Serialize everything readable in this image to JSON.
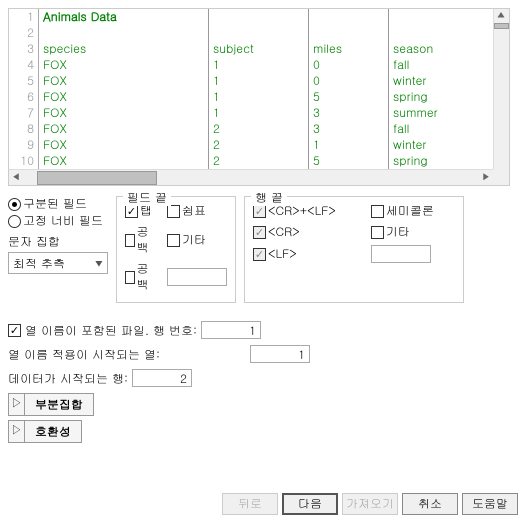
{
  "preview": {
    "line_numbers": [
      "1",
      "2",
      "3",
      "4",
      "5",
      "6",
      "7",
      "8",
      "9",
      "10"
    ],
    "title": "Animals Data",
    "blank": "",
    "cols": [
      [
        "species",
        "FOX",
        "FOX",
        "FOX",
        "FOX",
        "FOX",
        "FOX",
        "FOX"
      ],
      [
        "subject",
        "1",
        "1",
        "1",
        "1",
        "2",
        "2",
        "2"
      ],
      [
        "miles",
        "0",
        "0",
        "5",
        "3",
        "3",
        "1",
        "5"
      ],
      [
        "season",
        "fall",
        "winter",
        "spring",
        "summer",
        "fall",
        "winter",
        "spring"
      ]
    ]
  },
  "left": {
    "radio_delim": "구분된 필드",
    "radio_fixed": "고정 너비 필드",
    "charset_label": "문자 집합",
    "charset_value": "최적 추측"
  },
  "field_eol": {
    "title": "필드 끝",
    "tab": "탭",
    "semicolon": "쉼표",
    "space": "공백",
    "other": "기타",
    "spaces": "공백",
    "other_val": ""
  },
  "line_eol": {
    "title": "행 끝",
    "crlf": "<CR>+<LF>",
    "semi": "세미콜론",
    "cr": "<CR>",
    "other": "기타",
    "lf": "<LF>",
    "other_val": ""
  },
  "form": {
    "has_header": "열 이름이 포함된 파일. 행 번호:",
    "has_header_val": "1",
    "col_start": "열 이름 적용이 시작되는 열:",
    "col_start_val": "1",
    "data_start": "데이터가 시작되는 행:",
    "data_start_val": "2"
  },
  "expanders": {
    "subset": "부분집합",
    "compat": "호환성"
  },
  "buttons": {
    "back": "뒤로",
    "next": "다음",
    "import": "가져오기",
    "cancel": "취소",
    "help": "도움말"
  }
}
